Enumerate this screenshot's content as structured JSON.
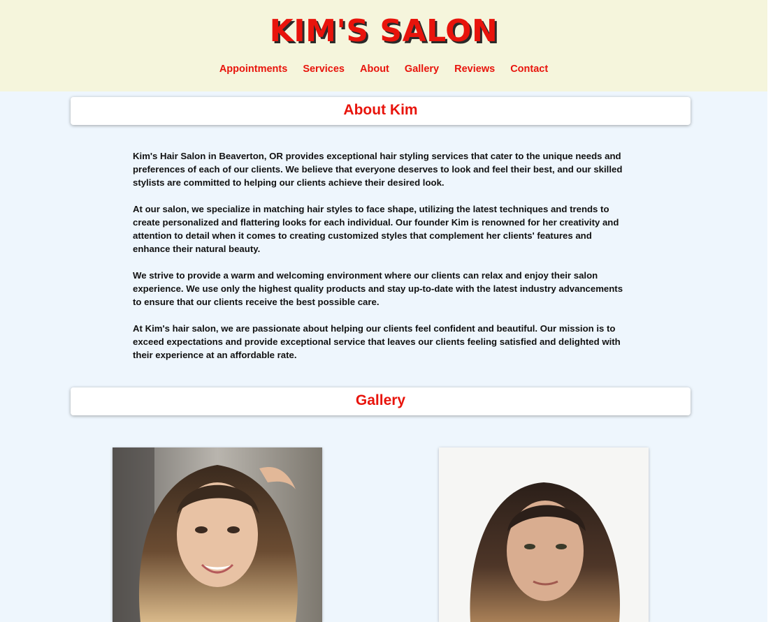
{
  "header": {
    "title": "KIM'S SALON",
    "nav": [
      "Appointments",
      "Services",
      "About",
      "Gallery",
      "Reviews",
      "Contact"
    ]
  },
  "about": {
    "heading": "About Kim",
    "paragraphs": [
      "Kim's Hair Salon in Beaverton, OR provides exceptional hair styling services that cater to the unique needs and preferences of each of our clients. We believe that everyone deserves to look and feel their best, and our skilled stylists are committed to helping our clients achieve their desired look.",
      "At our salon, we specialize in matching hair styles to face shape, utilizing the latest techniques and trends to create personalized and flattering looks for each individual. Our founder Kim is renowned for her creativity and attention to detail when it comes to creating customized styles that complement her clients' features and enhance their natural beauty.",
      "We strive to provide a warm and welcoming environment where our clients can relax and enjoy their salon experience. We use only the highest quality products and stay up-to-date with the latest industry advancements to ensure that our clients receive the best possible care.",
      "At Kim's hair salon, we are passionate about helping our clients feel confident and beautiful. Our mission is to exceed expectations and provide exceptional service that leaves our clients feeling satisfied and delighted with their experience at an affordable rate."
    ]
  },
  "gallery": {
    "heading": "Gallery"
  },
  "colors": {
    "accent": "#e8140c",
    "header_bg": "#f5f5dc",
    "page_bg": "#eef6fd"
  }
}
